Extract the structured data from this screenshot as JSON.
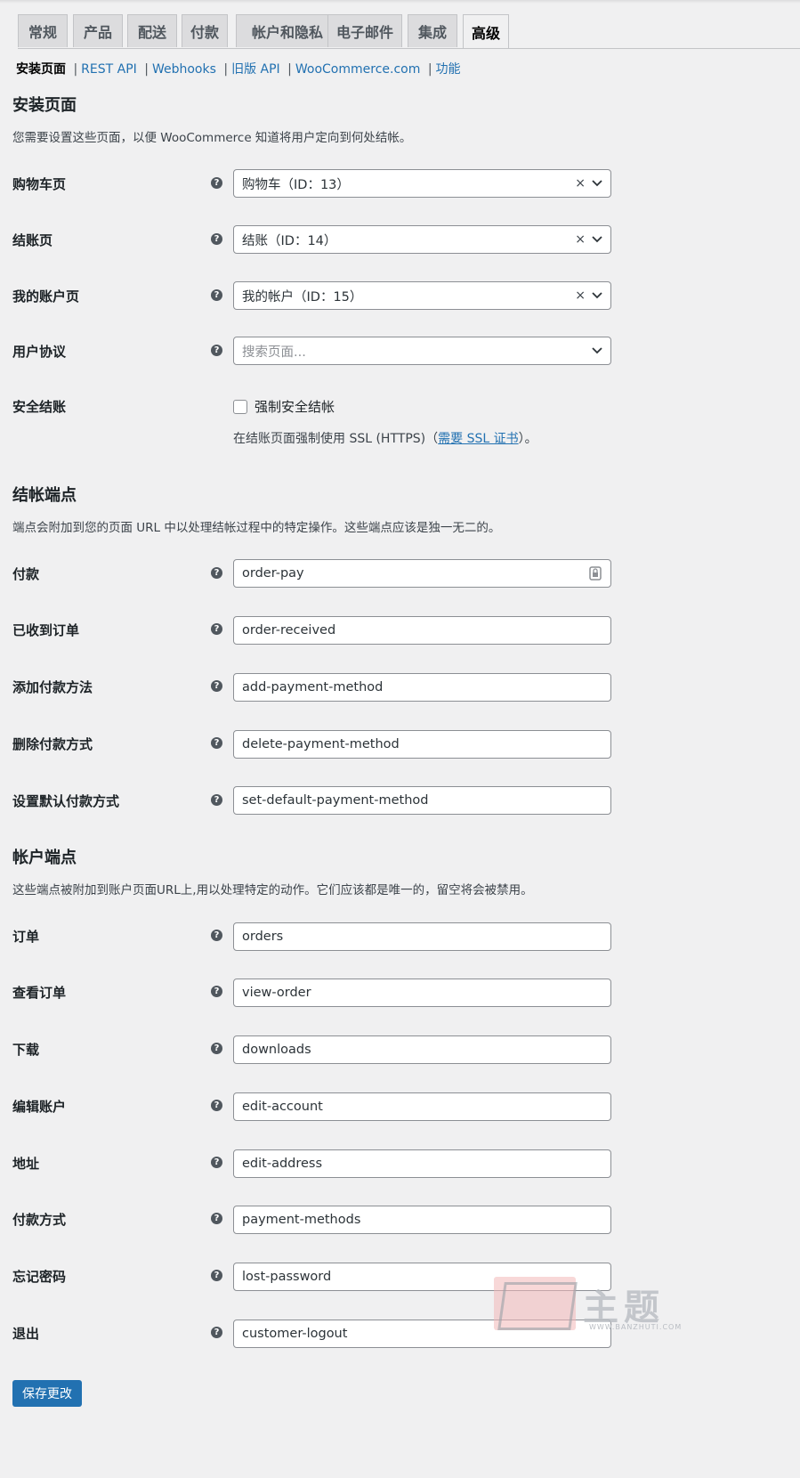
{
  "tabs": [
    "常规",
    "产品",
    "配送",
    "付款",
    "帐户和隐私",
    "电子邮件",
    "集成",
    "高级"
  ],
  "subsub": {
    "current": "安装页面",
    "links": [
      "REST API",
      "Webhooks",
      "旧版 API",
      "WooCommerce.com",
      "功能"
    ],
    "separator": "|"
  },
  "setup": {
    "title": "安装页面",
    "description": "您需要设置这些页面，以便 WooCommerce 知道将用户定向到何处结帐。",
    "cart": {
      "label": "购物车页",
      "value": "购物车（ID：13）"
    },
    "checkout": {
      "label": "结账页",
      "value": "结账（ID：14）"
    },
    "myaccount": {
      "label": "我的账户页",
      "value": "我的帐户（ID：15）"
    },
    "terms": {
      "label": "用户协议",
      "placeholder": "搜索页面..."
    },
    "secure": {
      "label": "安全结账",
      "checkbox_label": "强制安全结帐",
      "note_prefix": "在结账页面强制使用 SSL (HTTPS)（",
      "note_link": "需要 SSL 证书",
      "note_suffix": "）。"
    }
  },
  "checkout_endpoints": {
    "title": "结帐端点",
    "description": "端点会附加到您的页面 URL 中以处理结帐过程中的特定操作。这些端点应该是独一无二的。",
    "fields": [
      {
        "label": "付款",
        "value": "order-pay"
      },
      {
        "label": "已收到订单",
        "value": "order-received"
      },
      {
        "label": "添加付款方法",
        "value": "add-payment-method"
      },
      {
        "label": "删除付款方式",
        "value": "delete-payment-method"
      },
      {
        "label": "设置默认付款方式",
        "value": "set-default-payment-method"
      }
    ]
  },
  "account_endpoints": {
    "title": "帐户端点",
    "description": "这些端点被附加到账户页面URL上,用以处理特定的动作。它们应该都是唯一的，留空将会被禁用。",
    "fields": [
      {
        "label": "订单",
        "value": "orders"
      },
      {
        "label": "查看订单",
        "value": "view-order"
      },
      {
        "label": "下载",
        "value": "downloads"
      },
      {
        "label": "编辑账户",
        "value": "edit-account"
      },
      {
        "label": "地址",
        "value": "edit-address"
      },
      {
        "label": "付款方式",
        "value": "payment-methods"
      },
      {
        "label": "忘记密码",
        "value": "lost-password"
      },
      {
        "label": "退出",
        "value": "customer-logout"
      }
    ]
  },
  "help_glyph": "?",
  "clear_glyph": "×",
  "save_label": "保存更改",
  "watermark": {
    "text": "主题",
    "url": "WWW.BANZHUTI.COM"
  },
  "colors": {
    "accent": "#2271b1",
    "background": "#f0f0f1",
    "tab_inactive": "#dcdcde"
  },
  "icons": [
    "help-icon",
    "clear-icon",
    "chevron-down-icon",
    "password-key-icon"
  ]
}
